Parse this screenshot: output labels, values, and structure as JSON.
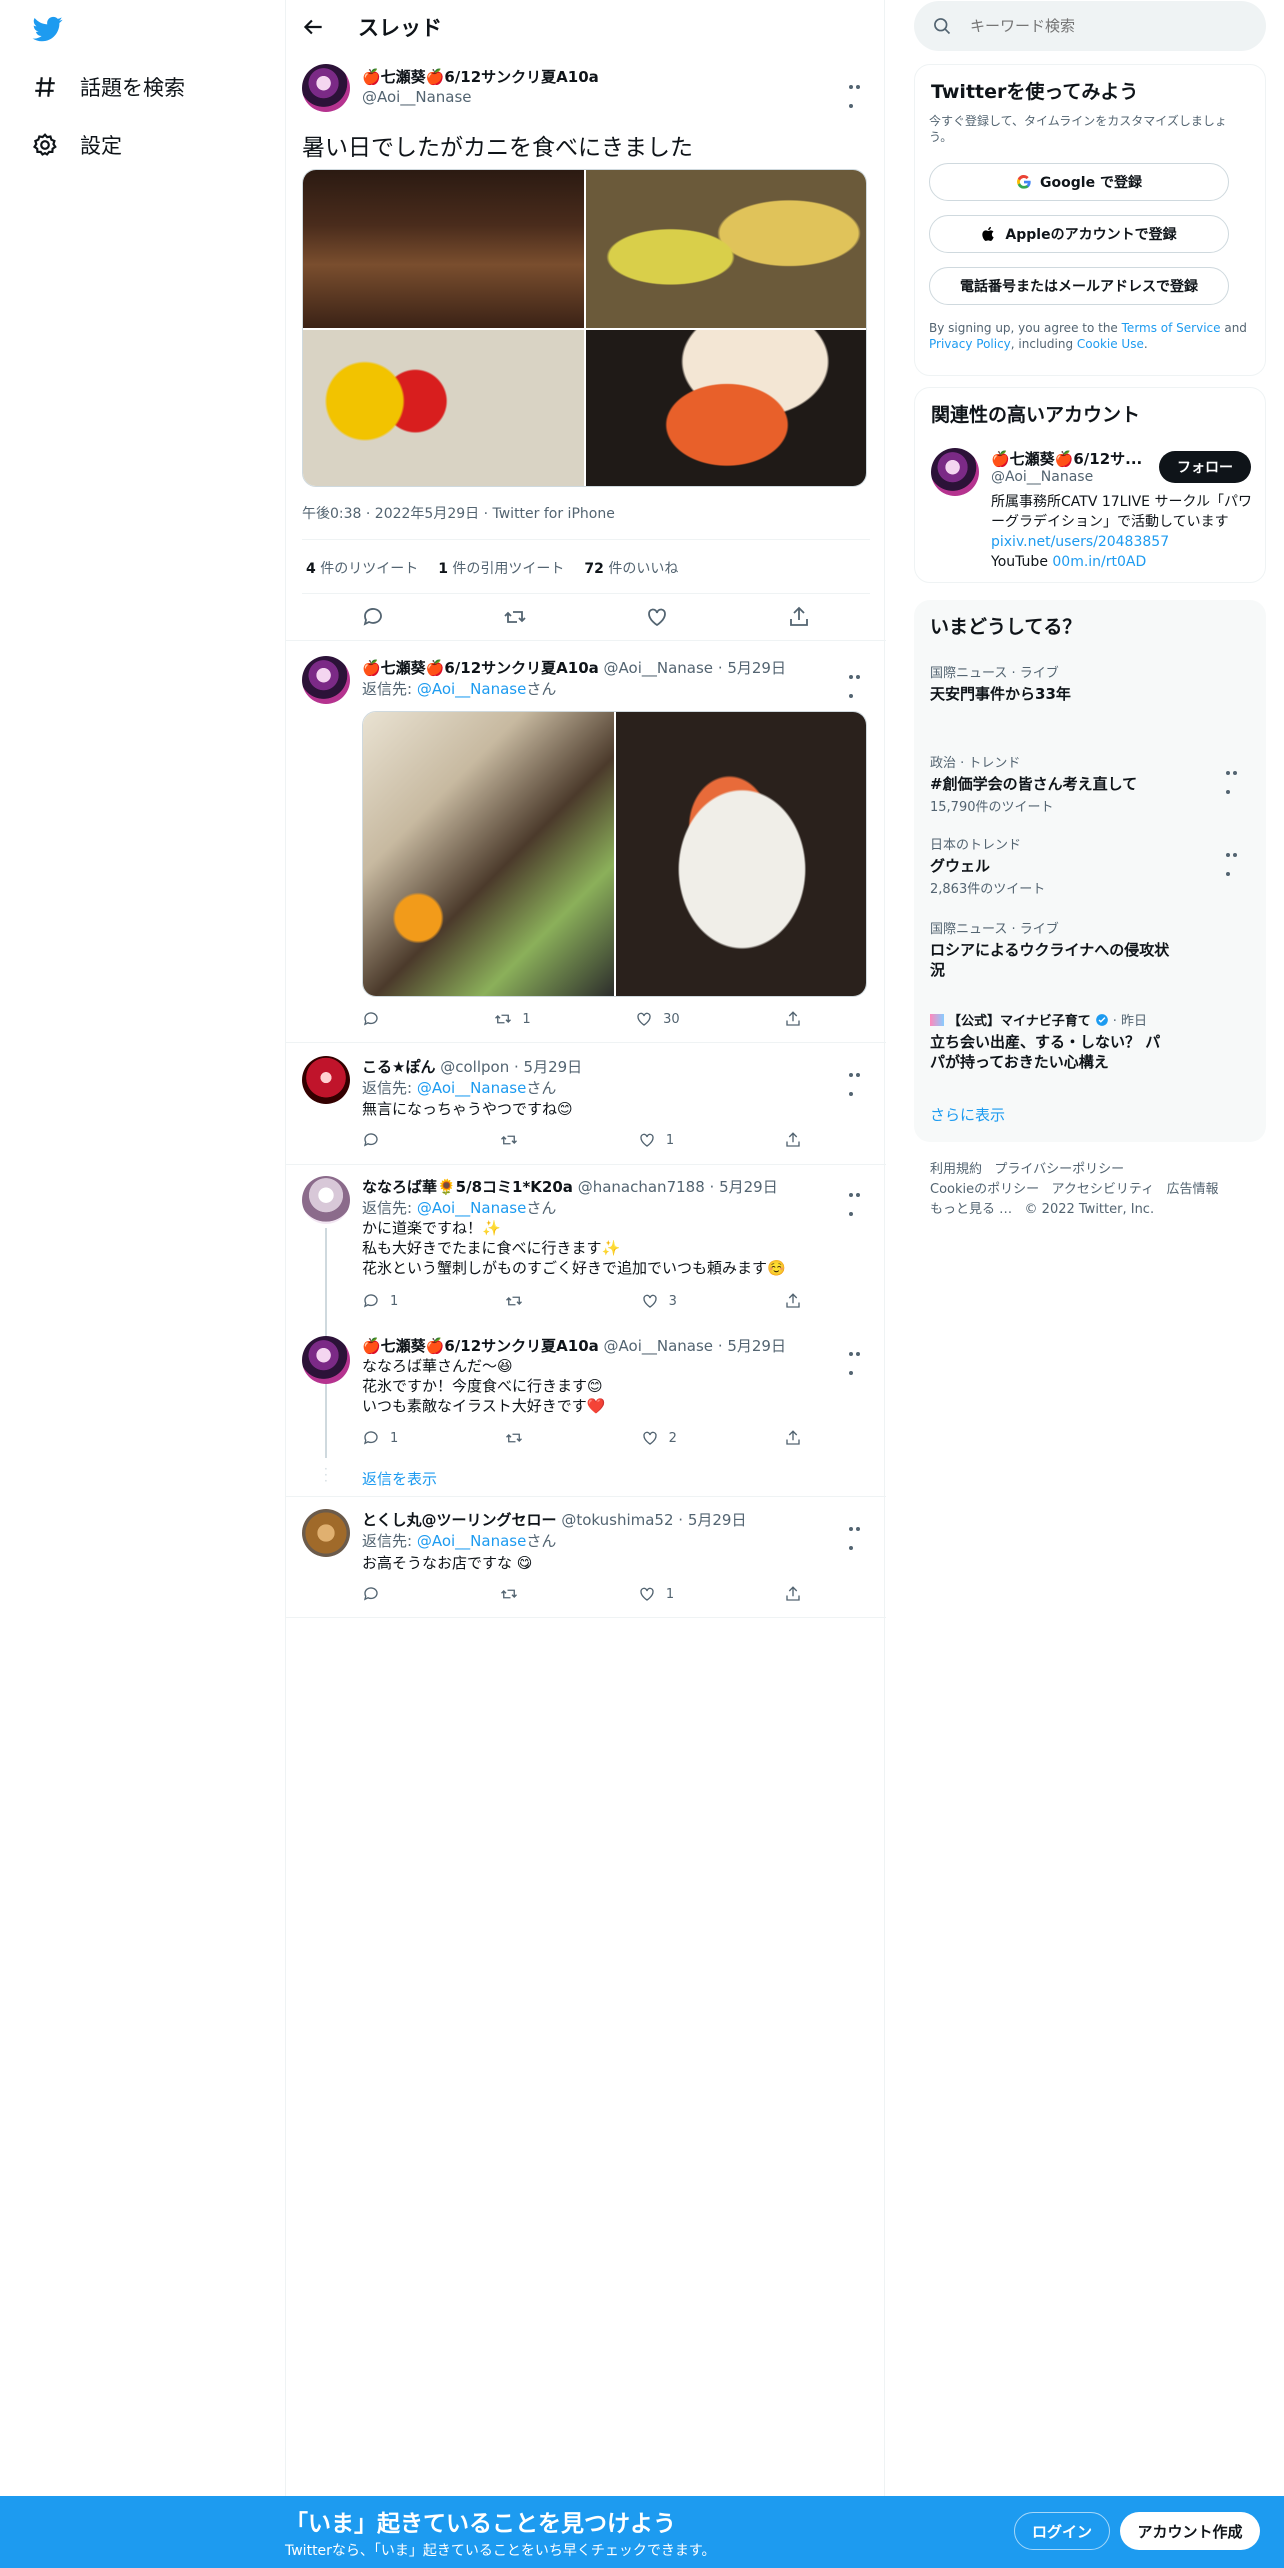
{
  "nav": {
    "explore_label": "話題を検索",
    "settings_label": "設定"
  },
  "header": {
    "title": "スレッド"
  },
  "main_tweet": {
    "display_name": "🍎七瀬葵🍎6/12サンクリ夏A10a",
    "handle": "@Aoi__Nanase",
    "text": "暑い日でしたがカニを食べにきました",
    "meta": "午後0:38 · 2022年5月29日 · Twitter for iPhone",
    "retweets_count": "4",
    "retweets_label": "件のリツイート",
    "quotes_count": "1",
    "quotes_label": "件の引用ツイート",
    "likes_count": "72",
    "likes_label": "件のいいね"
  },
  "replies": [
    {
      "display_name": "🍎七瀬葵🍎6/12サンクリ夏A10a",
      "handle": "@Aoi__Nanase",
      "date": "· 5月29日",
      "reply_prefix": "返信先: ",
      "reply_to": "@Aoi__Nanase",
      "reply_suffix": "さん",
      "text": "",
      "reply_count": "",
      "retweet_count": "1",
      "like_count": "30"
    },
    {
      "display_name": "こる★ぽん",
      "handle": "@collpon",
      "date": "· 5月29日",
      "reply_prefix": "返信先: ",
      "reply_to": "@Aoi__Nanase",
      "reply_suffix": "さん",
      "text": "無言になっちゃうやつですね😊",
      "reply_count": "",
      "retweet_count": "",
      "like_count": "1"
    },
    {
      "display_name": "ななろば華🌻5/8コミ1*K20a",
      "handle": "@hanachan7188",
      "date": "· 5月29日",
      "reply_prefix": "返信先: ",
      "reply_to": "@Aoi__Nanase",
      "reply_suffix": "さん",
      "text_lines": [
        "かに道楽ですね！✨",
        "私も大好きでたまに食べに行きます✨",
        "花氷という蟹刺しがものすごく好きで追加でいつも頼みます☺️"
      ],
      "reply_count": "1",
      "retweet_count": "",
      "like_count": "3"
    },
    {
      "display_name": "🍎七瀬葵🍎6/12サンクリ夏A10a",
      "handle": "@Aoi__Nanase",
      "date": "· 5月29日",
      "text_lines": [
        "ななろば華さんだ〜😆",
        "花氷ですか！今度食べに行きます😊",
        "いつも素敵なイラスト大好きです❤️"
      ],
      "reply_count": "1",
      "retweet_count": "",
      "like_count": "2"
    },
    {
      "display_name": "とくし丸@ツーリングセロー",
      "handle": "@tokushima52",
      "date": "· 5月29日",
      "reply_prefix": "返信先: ",
      "reply_to": "@Aoi__Nanase",
      "reply_suffix": "さん",
      "text": "お高そうなお店ですな 😋",
      "reply_count": "",
      "retweet_count": "",
      "like_count": "1"
    }
  ],
  "show_replies_label": "返信を表示",
  "search": {
    "placeholder": "キーワード検索"
  },
  "signup": {
    "title": "Twitterを使ってみよう",
    "subtitle": "今すぐ登録して、タイムラインをカスタマイズしましょう。",
    "google_label": "Google で登録",
    "apple_label": "Appleのアカウントで登録",
    "phone_label": "電話番号またはメールアドレスで登録",
    "terms_prefix": "By signing up, you agree to the ",
    "terms_link": "Terms of Service",
    "terms_and": " and ",
    "privacy_link": "Privacy Policy",
    "including": ", including ",
    "cookie_link": "Cookie Use",
    "period": "."
  },
  "related": {
    "title": "関連性の高いアカウント",
    "display_name": "🍎七瀬葵🍎6/12サ...",
    "handle": "@Aoi__Nanase",
    "follow_label": "フォロー",
    "bio_text": "所属事務所CATV 17LIVE サークル「パワーグラデイション」で活動しています ",
    "bio_link": "pixiv.net/users/20483857",
    "bio_youtube": "YouTube ",
    "bio_link2": "00m.in/rt0AD"
  },
  "trends": {
    "title": "いまどうしてる？",
    "items": [
      {
        "category": "国際ニュース · ライブ",
        "title": "天安門事件から33年",
        "count": ""
      },
      {
        "category": "政治 · トレンド",
        "title": "#創価学会の皆さん考え直して",
        "count": "15,790件のツイート"
      },
      {
        "category": "日本のトレンド",
        "title": "グウェル",
        "count": "2,863件のツイート"
      },
      {
        "category": "国際ニュース · ライブ",
        "title": "ロシアによるウクライナへの侵攻状況",
        "count": ""
      },
      {
        "category": "【公式】マイナビ子育て",
        "time": "· 昨日",
        "title": "立ち会い出産、する・しない？ パパが持っておきたい心構え",
        "count": ""
      }
    ],
    "show_more": "さらに表示"
  },
  "footer": {
    "terms": "利用規約",
    "privacy": "プライバシーポリシー",
    "cookie": "Cookieのポリシー",
    "accessibility": "アクセシビリティ",
    "ads": "広告情報",
    "more": "もっと見る …",
    "copyright": "© 2022 Twitter, Inc."
  },
  "bottom_bar": {
    "title": "「いま」起きていることを見つけよう",
    "subtitle": "Twitterなら、「いま」起きていることをいち早くチェックできます。",
    "login_label": "ログイン",
    "signup_label": "アカウント作成"
  },
  "colors": {
    "accent": "#1d9bf0",
    "text": "#0f1419",
    "muted": "#536471",
    "border": "#eff3f4",
    "like_red": "#f91880"
  }
}
